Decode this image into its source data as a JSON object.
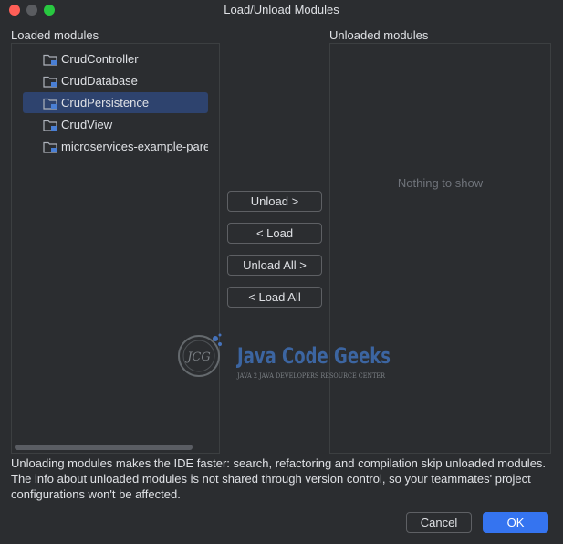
{
  "window": {
    "title": "Load/Unload Modules"
  },
  "loaded": {
    "label": "Loaded modules",
    "items": [
      {
        "label": "CrudController",
        "selected": false
      },
      {
        "label": "CrudDatabase",
        "selected": false
      },
      {
        "label": "CrudPersistence",
        "selected": true
      },
      {
        "label": "CrudView",
        "selected": false
      },
      {
        "label": "microservices-example-parent",
        "selected": false
      }
    ]
  },
  "unloaded": {
    "label": "Unloaded modules",
    "empty_text": "Nothing to show"
  },
  "actions": {
    "unload": "Unload >",
    "load": "< Load",
    "unload_all": "Unload All >",
    "load_all": "< Load All"
  },
  "info": {
    "text": "Unloading modules makes the IDE faster: search, refactoring and compilation skip unloaded modules. The info about unloaded modules is not shared through version control, so your teammates' project configurations won't be affected."
  },
  "footer": {
    "cancel": "Cancel",
    "ok": "OK"
  },
  "watermark": {
    "brand": "Java Code Geeks",
    "tagline": "JAVA 2 JAVA DEVELOPERS RESOURCE CENTER",
    "logo_text": "JCG"
  },
  "colors": {
    "accent": "#3574f0",
    "selection": "#2e436e",
    "background": "#2b2d30"
  }
}
